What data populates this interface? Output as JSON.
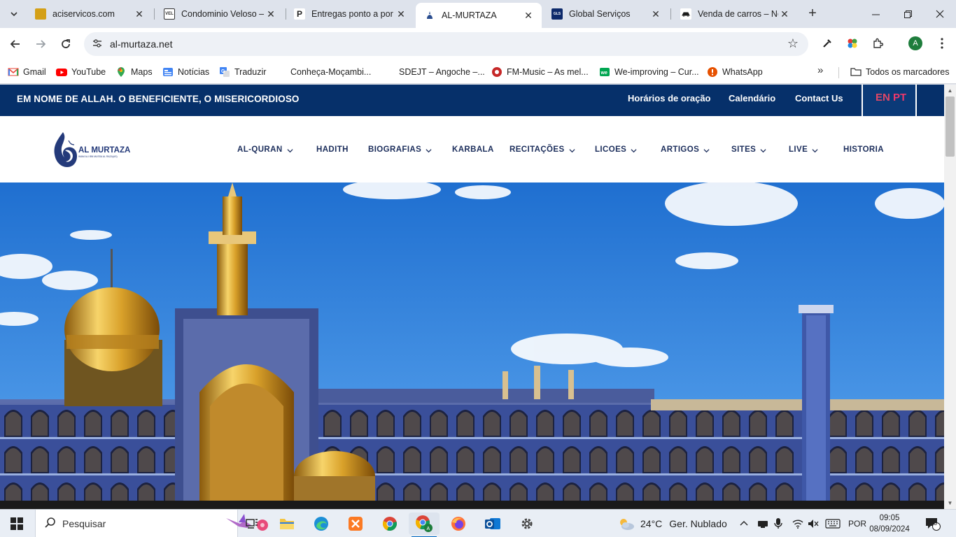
{
  "browser": {
    "tabs": [
      {
        "title": "aciservicos.com",
        "favicon_color": "#d4a017",
        "active": false
      },
      {
        "title": "Condominio Veloso –",
        "favicon_color": "#3b3b3b",
        "active": false
      },
      {
        "title": "Entregas ponto a por",
        "favicon_color": "#222222",
        "active": false
      },
      {
        "title": "AL-MURTAZA",
        "favicon_color": "#2a4d8f",
        "active": true
      },
      {
        "title": "Global Serviços",
        "favicon_color": "#0d2a6b",
        "active": false
      },
      {
        "title": "Venda de carros – No",
        "favicon_color": "#1c1c1c",
        "active": false
      }
    ],
    "url": "al-murtaza.net",
    "bookmarks": [
      {
        "label": "Gmail",
        "color": "#ea4335"
      },
      {
        "label": "YouTube",
        "color": "#ff0000"
      },
      {
        "label": "Maps",
        "color": "#34a853"
      },
      {
        "label": "Notícias",
        "color": "#4285f4"
      },
      {
        "label": "Traduzir",
        "color": "#4285f4"
      },
      {
        "label": "Conheça-Moçambi...",
        "color": ""
      },
      {
        "label": "SDEJT – Angoche –...",
        "color": ""
      },
      {
        "label": "FM-Music – As mel...",
        "color": "#c62828"
      },
      {
        "label": "We-improving – Cur...",
        "color": "#00a651"
      },
      {
        "label": "WhatsApp",
        "color": "#e65100"
      }
    ],
    "all_bookmarks": "Todos os marcadores",
    "profile_initial": "A"
  },
  "site": {
    "motto": "EM NOME DE ALLAH. O BENEFICIENTE, O MISERICORDIOSO",
    "top_links": [
      "Horários de oração",
      "Calendário",
      "Contact Us"
    ],
    "lang_en": "EN",
    "lang_pt": "PT",
    "logo_text": "AL MURTAZA",
    "logo_subtext": "IMAM ALI IBN MUSSA AL RAZA(AS)",
    "nav": [
      {
        "label": "AL-QURAN",
        "dropdown": true
      },
      {
        "label": "HADITH",
        "dropdown": false
      },
      {
        "label": "BIOGRAFIAS",
        "dropdown": true
      },
      {
        "label": "KARBALA",
        "dropdown": false
      },
      {
        "label": "RECITAÇÕES",
        "dropdown": true
      },
      {
        "label": "LICOES",
        "dropdown": true
      },
      {
        "label": "ARTIGOS",
        "dropdown": true
      },
      {
        "label": "SITES",
        "dropdown": true
      },
      {
        "label": "LIVE",
        "dropdown": true
      },
      {
        "label": "HISTORIA",
        "dropdown": false
      }
    ]
  },
  "taskbar": {
    "search_placeholder": "Pesquisar",
    "weather_temp": "24°C",
    "weather_desc": "Ger. Nublado",
    "language": "POR",
    "time": "09:05",
    "date": "08/09/2024",
    "notifications": "8"
  }
}
